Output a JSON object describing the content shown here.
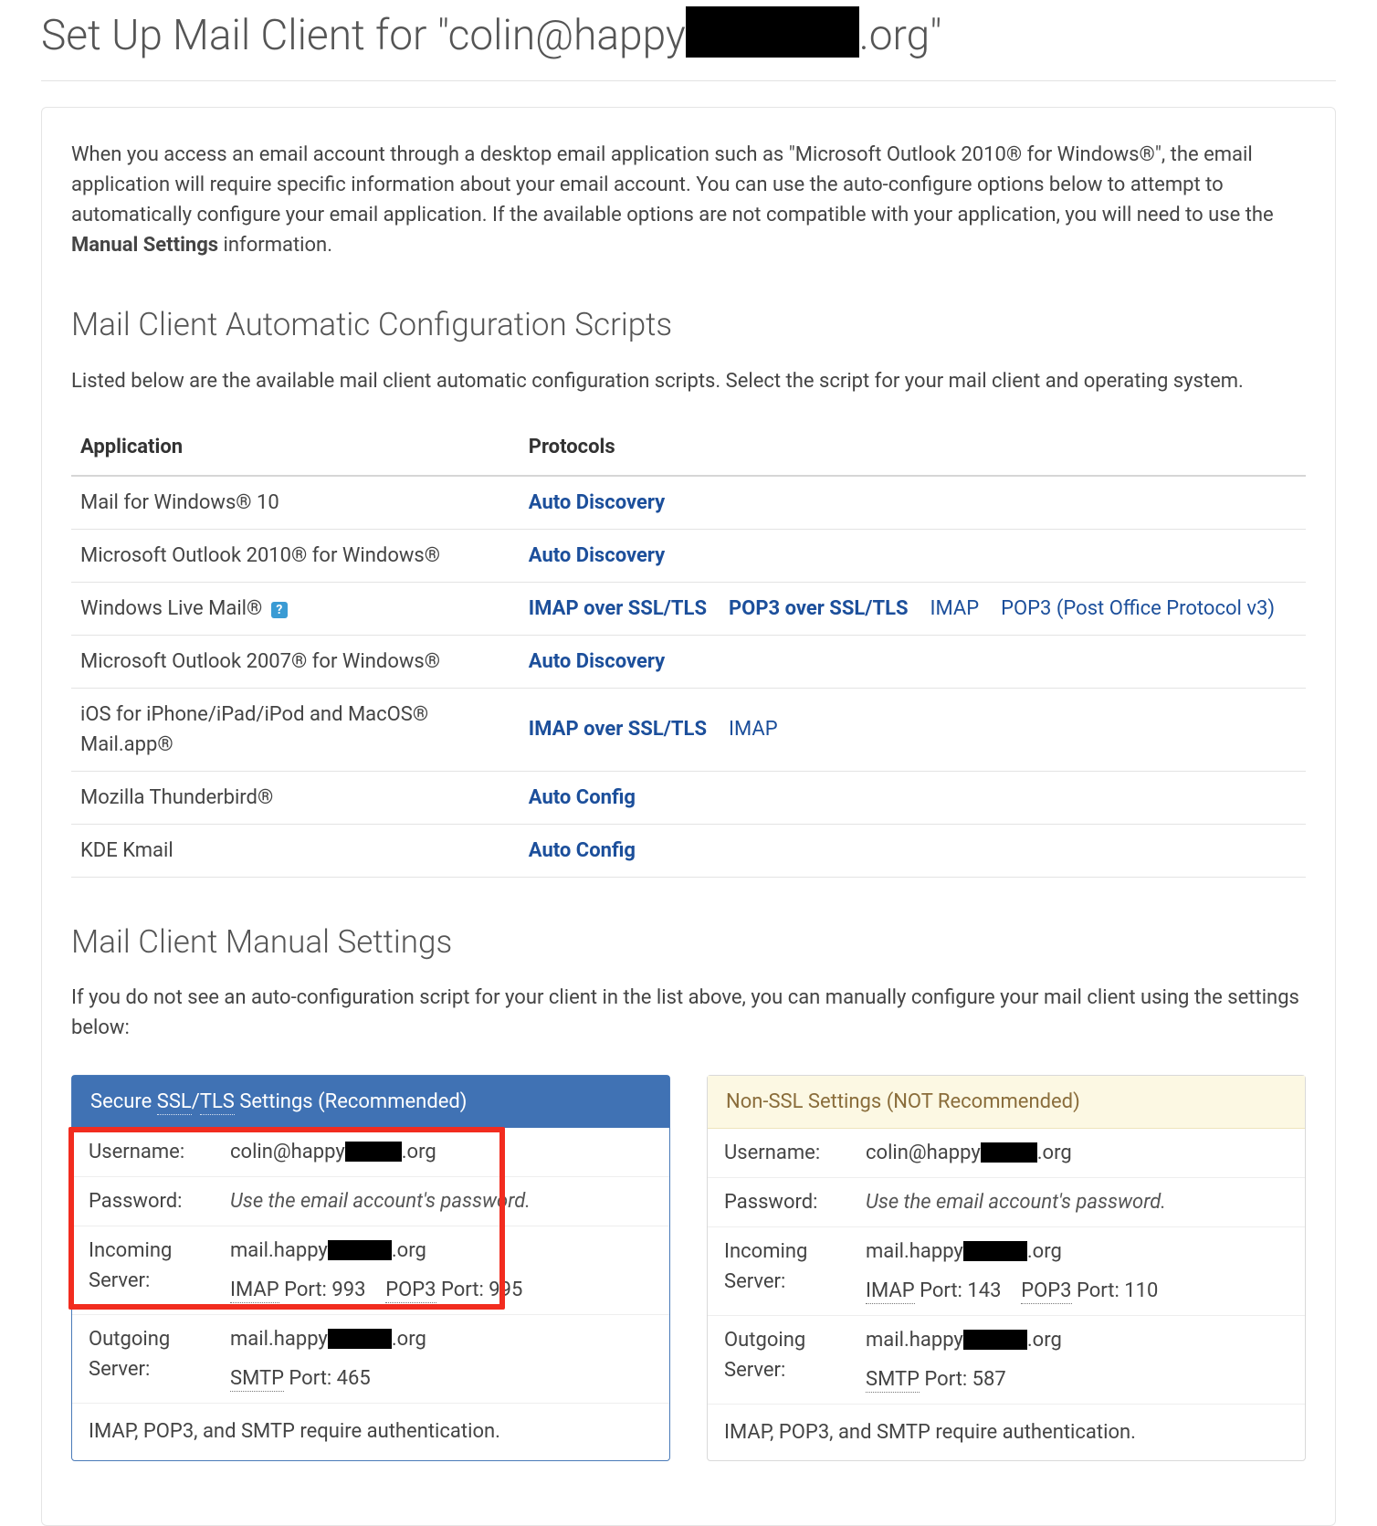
{
  "page": {
    "title_pre": "Set Up Mail Client for \"colin@happy",
    "title_post": ".org\""
  },
  "intro": {
    "text_a": "When you access an email account through a desktop email application such as \"Microsoft Outlook 2010® for Windows®\", the email application will require specific information about your email account. You can use the auto-configure options below to attempt to automatically configure your email application. If the available options are not compatible with your application, you will need to use the ",
    "text_bold": "Manual Settings",
    "text_b": " information."
  },
  "scripts": {
    "heading": "Mail Client Automatic Configuration Scripts",
    "sub": "Listed below are the available mail client automatic configuration scripts. Select the script for your mail client and operating system.",
    "th_app": "Application",
    "th_proto": "Protocols",
    "rows": [
      {
        "app": "Mail for Windows® 10",
        "protocols": [
          {
            "label": "Auto Discovery",
            "bold": true
          }
        ]
      },
      {
        "app": "Microsoft Outlook 2010® for Windows®",
        "protocols": [
          {
            "label": "Auto Discovery",
            "bold": true
          }
        ]
      },
      {
        "app": "Windows Live Mail®",
        "help": true,
        "protocols": [
          {
            "label": "IMAP over SSL/TLS",
            "bold": true
          },
          {
            "label": "POP3 over SSL/TLS",
            "bold": true
          },
          {
            "label": "IMAP",
            "bold": false
          },
          {
            "label": "POP3 (Post Office Protocol v3)",
            "bold": false
          }
        ]
      },
      {
        "app": "Microsoft Outlook 2007® for Windows®",
        "protocols": [
          {
            "label": "Auto Discovery",
            "bold": true
          }
        ]
      },
      {
        "app": "iOS for iPhone/iPad/iPod and MacOS® Mail.app®",
        "protocols": [
          {
            "label": "IMAP over SSL/TLS",
            "bold": true
          },
          {
            "label": "IMAP",
            "bold": false
          }
        ]
      },
      {
        "app": "Mozilla Thunderbird®",
        "protocols": [
          {
            "label": "Auto Config",
            "bold": true
          }
        ]
      },
      {
        "app": "KDE Kmail",
        "protocols": [
          {
            "label": "Auto Config",
            "bold": true
          }
        ]
      }
    ]
  },
  "manual": {
    "heading": "Mail Client Manual Settings",
    "sub": "If you do not see an auto-configuration script for your client in the list above, you can manually configure your mail client using the settings below:",
    "labels": {
      "username": "Username:",
      "password": "Password:",
      "incoming": "Incoming Server:",
      "outgoing": "Outgoing Server:",
      "imap_abbr": "IMAP",
      "pop3_abbr": "POP3",
      "smtp_abbr": "SMTP"
    },
    "ssl": {
      "title_pre": "Secure ",
      "title_ssl": "SSL",
      "title_slash": "/",
      "title_tls": "TLS",
      "title_post": " Settings (Recommended)",
      "username_pre": "colin@happy",
      "username_post": ".org",
      "password_hint": "Use the email account's password.",
      "incoming_host_pre": "mail.happy",
      "incoming_host_post": ".org",
      "imap_port": " Port: 993",
      "pop3_port": " Port: 995",
      "outgoing_host_pre": "mail.happy",
      "outgoing_host_post": ".org",
      "smtp_port": " Port: 465",
      "auth_note": "IMAP, POP3, and SMTP require authentication."
    },
    "nonssl": {
      "title": "Non-SSL Settings (NOT Recommended)",
      "username_pre": "colin@happy",
      "username_post": ".org",
      "password_hint": "Use the email account's password.",
      "incoming_host_pre": "mail.happy",
      "incoming_host_post": ".org",
      "imap_port": " Port: 143",
      "pop3_port": " Port: 110",
      "outgoing_host_pre": "mail.happy",
      "outgoing_host_post": ".org",
      "smtp_port": " Port: 587",
      "auth_note": "IMAP, POP3, and SMTP require authentication."
    }
  }
}
